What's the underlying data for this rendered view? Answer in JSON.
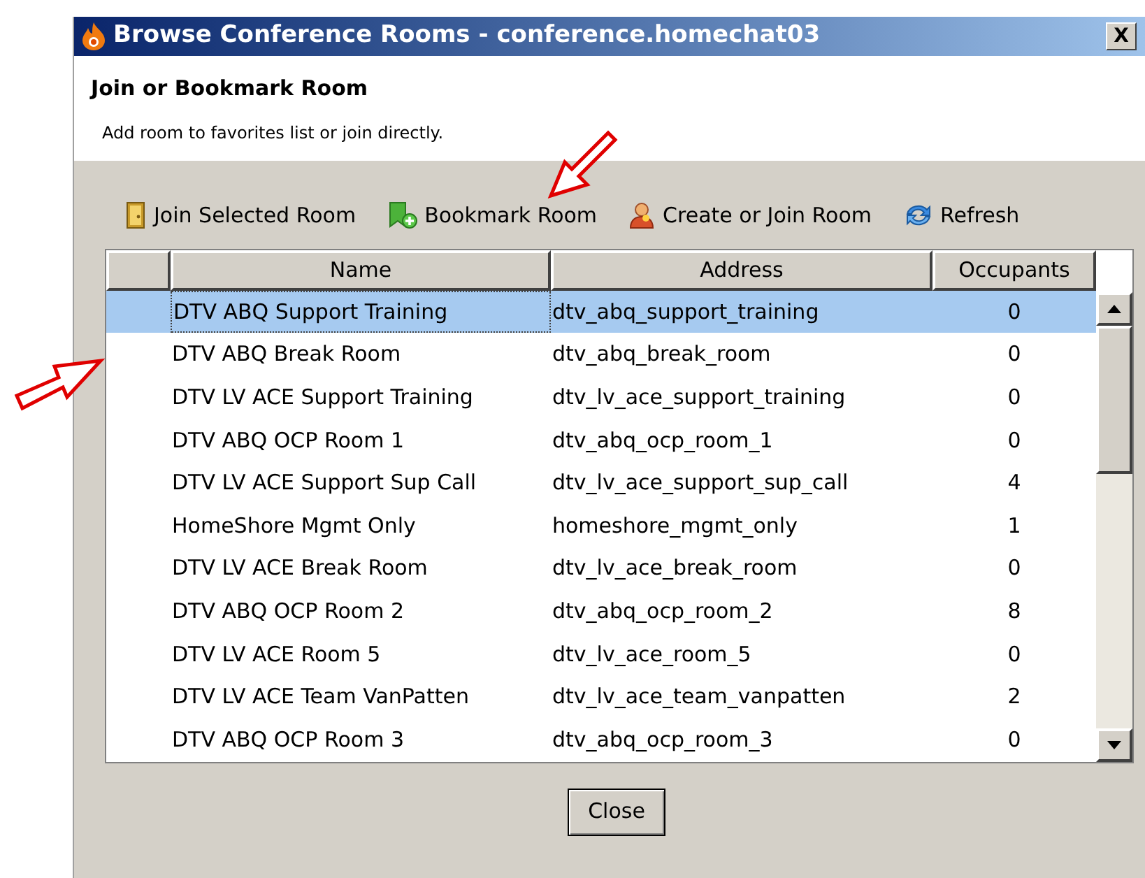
{
  "window": {
    "title": "Browse Conference Rooms - conference.homechat03",
    "close": "X"
  },
  "header": {
    "title": "Join or Bookmark Room",
    "subtitle": "Add room to favorites list or join directly."
  },
  "toolbar": [
    {
      "kind": "join",
      "label": "Join Selected Room"
    },
    {
      "kind": "bookmark",
      "label": "Bookmark Room"
    },
    {
      "kind": "create",
      "label": "Create or Join Room"
    },
    {
      "kind": "refresh",
      "label": "Refresh"
    }
  ],
  "table": {
    "columns": [
      "Name",
      "Address",
      "Occupants"
    ],
    "rows": [
      {
        "name": "DTV ABQ Support Training",
        "address": "dtv_abq_support_training",
        "occupants": "0",
        "selected": true
      },
      {
        "name": "DTV ABQ Break Room",
        "address": "dtv_abq_break_room",
        "occupants": "0",
        "selected": false
      },
      {
        "name": "DTV LV ACE Support Training",
        "address": "dtv_lv_ace_support_training",
        "occupants": "0",
        "selected": false
      },
      {
        "name": "DTV ABQ OCP Room 1",
        "address": "dtv_abq_ocp_room_1",
        "occupants": "0",
        "selected": false
      },
      {
        "name": "DTV LV ACE Support Sup Call",
        "address": "dtv_lv_ace_support_sup_call",
        "occupants": "4",
        "selected": false
      },
      {
        "name": "HomeShore Mgmt Only",
        "address": "homeshore_mgmt_only",
        "occupants": "1",
        "selected": false
      },
      {
        "name": "DTV LV ACE Break Room",
        "address": "dtv_lv_ace_break_room",
        "occupants": "0",
        "selected": false
      },
      {
        "name": "DTV ABQ OCP Room 2",
        "address": "dtv_abq_ocp_room_2",
        "occupants": "8",
        "selected": false
      },
      {
        "name": "DTV LV ACE Room 5",
        "address": "dtv_lv_ace_room_5",
        "occupants": "0",
        "selected": false
      },
      {
        "name": "DTV LV ACE Team VanPatten",
        "address": "dtv_lv_ace_team_vanpatten",
        "occupants": "2",
        "selected": false
      },
      {
        "name": "DTV ABQ OCP Room 3",
        "address": "dtv_abq_ocp_room_3",
        "occupants": "0",
        "selected": false
      }
    ]
  },
  "buttons": [
    "Close"
  ]
}
